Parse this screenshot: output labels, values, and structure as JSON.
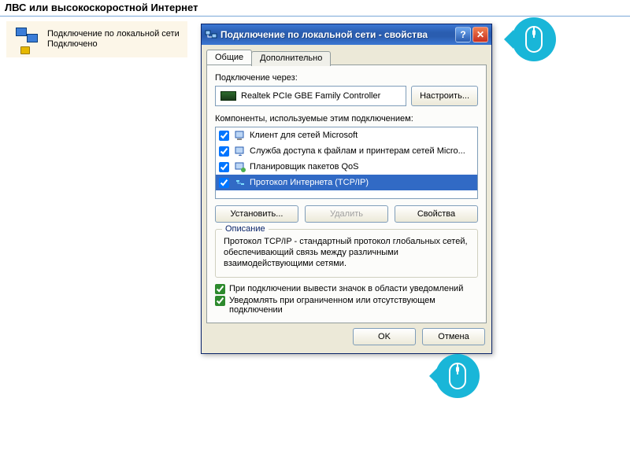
{
  "section_header": "ЛВС или высокоскоростной Интернет",
  "connection": {
    "name": "Подключение по локальной сети",
    "status": "Подключено"
  },
  "dialog": {
    "title": "Подключение по локальной сети - свойства",
    "tabs": {
      "general": "Общие",
      "advanced": "Дополнительно"
    },
    "connect_via_label": "Подключение через:",
    "adapter_name": "Realtek PCIe GBE Family Controller",
    "configure_btn": "Настроить...",
    "components_label": "Компоненты, используемые этим подключением:",
    "components": [
      {
        "label": "Клиент для сетей Microsoft",
        "checked": true,
        "selected": false,
        "icon": "client"
      },
      {
        "label": "Служба доступа к файлам и принтерам сетей Micro...",
        "checked": true,
        "selected": false,
        "icon": "service"
      },
      {
        "label": "Планировщик пакетов QoS",
        "checked": true,
        "selected": false,
        "icon": "qos"
      },
      {
        "label": "Протокол Интернета (TCP/IP)",
        "checked": true,
        "selected": true,
        "icon": "protocol"
      }
    ],
    "btn_install": "Установить...",
    "btn_uninstall": "Удалить",
    "btn_properties": "Свойства",
    "desc_legend": "Описание",
    "desc_text": "Протокол TCP/IP - стандартный протокол глобальных сетей, обеспечивающий связь между различными взаимодействующими сетями.",
    "chk_tray": "При подключении вывести значок в области уведомлений",
    "chk_notify": "Уведомлять при ограниченном или отсутствующем подключении",
    "btn_ok": "OK",
    "btn_cancel": "Отмена"
  }
}
